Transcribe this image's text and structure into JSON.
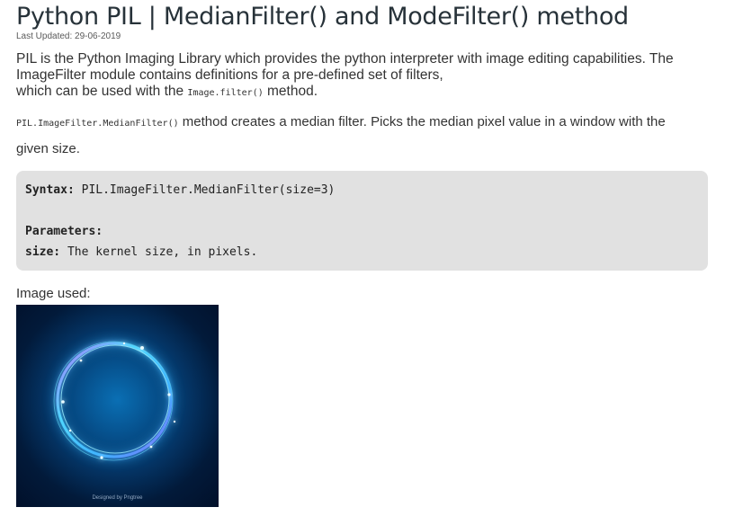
{
  "article": {
    "title": "Python PIL | MedianFilter() and ModeFilter() method",
    "last_updated": "Last Updated: 29-06-2019",
    "intro_line1": "PIL is the Python Imaging Library which provides the python interpreter with image editing capabilities. The",
    "intro_line2": "ImageFilter module contains definitions for a pre-defined set of filters,",
    "intro_line3_prefix": "which can be used with the ",
    "intro_line3_code": "Image.filter()",
    "intro_line3_suffix": " method.",
    "desc_code": "PIL.ImageFilter.MedianFilter()",
    "desc_text_line1": " method creates a median filter. Picks the median pixel value in a window with the",
    "desc_text_line2": "given size."
  },
  "codebox": {
    "syntax_label": "Syntax:",
    "syntax_value": " PIL.ImageFilter.MedianFilter(size=3)",
    "parameters_label": "Parameters:",
    "size_label": "size:",
    "size_value": " The kernel size, in pixels."
  },
  "image_section": {
    "label": "Image used:",
    "credit": "Designed by Pngtree"
  },
  "colors": {
    "text": "#273239",
    "code_bg": "#e1e1e1",
    "image_bg": "#043566",
    "ring": "#4fd6ff"
  }
}
